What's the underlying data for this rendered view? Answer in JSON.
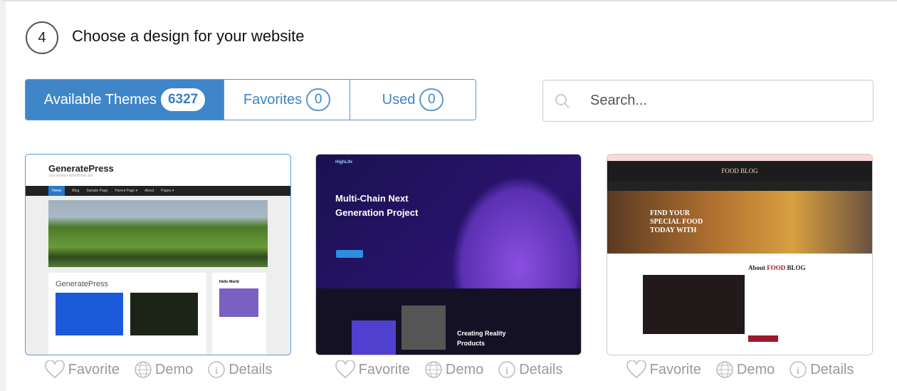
{
  "step": {
    "number": "4",
    "title": "Choose a design for your website"
  },
  "tabs": [
    {
      "label": "Available Themes",
      "count": "6327",
      "active": true
    },
    {
      "label": "Favorites",
      "count": "0"
    },
    {
      "label": "Used",
      "count": "0"
    }
  ],
  "search": {
    "placeholder": "Search...",
    "value": "",
    "icon": "search-icon"
  },
  "accent": "#3f86c8",
  "themes": [
    {
      "name": "GeneratePress",
      "preview": {
        "heading": "GeneratePress",
        "tagline": "Just another WordPress site",
        "nav": [
          "Home",
          "Blog",
          "Sample Page",
          "Parent Page ▾",
          "About",
          "Pages ▾"
        ],
        "sidebar_title": "Hello World"
      }
    },
    {
      "name": "HighLife",
      "preview": {
        "logo": "HighLife",
        "headline": "Multi-Chain Next Generation Project",
        "subheadline": "Creating Reality Products"
      }
    },
    {
      "name": "Food Blog",
      "preview": {
        "logo": "FOOD BLOG",
        "headline": "FIND YOUR SPECIAL FOOD TODAY WITH",
        "about_prefix": "About",
        "about_highlight": "FOOD",
        "about_suffix": "BLOG"
      }
    }
  ],
  "actions": {
    "favorite": "Favorite",
    "demo": "Demo",
    "details": "Details"
  }
}
